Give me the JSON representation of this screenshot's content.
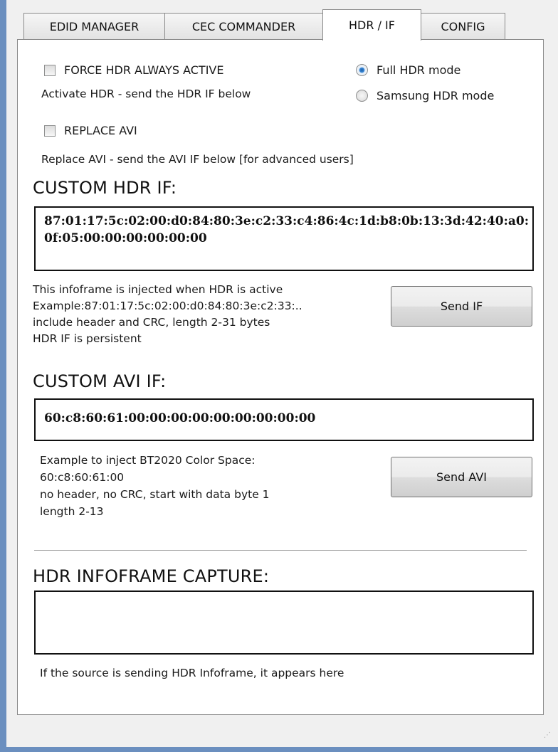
{
  "tabs": [
    {
      "label": "EDID MANAGER"
    },
    {
      "label": "CEC COMMANDER"
    },
    {
      "label": "HDR / IF"
    },
    {
      "label": "CONFIG"
    }
  ],
  "options": {
    "force_hdr_label": "FORCE HDR ALWAYS ACTIVE",
    "force_hdr_checked": false,
    "force_hdr_desc": "Activate HDR - send the HDR IF below",
    "replace_avi_label": "REPLACE AVI",
    "replace_avi_checked": false,
    "replace_avi_desc": "Replace AVI - send the AVI IF below [for advanced users]",
    "hdr_mode_full": "Full HDR mode",
    "hdr_mode_samsung": "Samsung HDR mode",
    "hdr_mode_selected": "Full HDR mode"
  },
  "custom_hdr": {
    "heading": "CUSTOM HDR IF:",
    "value": "87:01:17:5c:02:00:d0:84:80:3e:c2:33:c4:86:4c:1d:b8:0b:13:3d:42:40:a0:0f:05:00:00:00:00:00:00",
    "info_line1": "This infoframe is injected when HDR is active",
    "info_line2": "Example:87:01:17:5c:02:00:d0:84:80:3e:c2:33:..",
    "info_line3": "include header and CRC, length 2-31 bytes",
    "info_line4": "HDR IF is persistent",
    "send_label": "Send IF"
  },
  "custom_avi": {
    "heading": "CUSTOM AVI IF:",
    "value": "60:c8:60:61:00:00:00:00:00:00:00:00:00",
    "info_line1": "Example to inject BT2020 Color Space:",
    "info_line2": "60:c8:60:61:00",
    "info_line3": "no header, no CRC, start with data byte 1",
    "info_line4": "length 2-13",
    "send_label": "Send AVI"
  },
  "capture": {
    "heading": "HDR INFOFRAME CAPTURE:",
    "value": "",
    "hint": "If the source is sending HDR Infoframe, it appears here"
  },
  "colors": {
    "window_frame": "#6b8fbf",
    "radio_selected": "#2a73c4"
  }
}
